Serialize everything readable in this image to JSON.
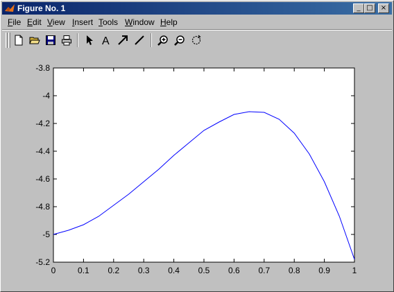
{
  "window": {
    "title": "Figure No. 1",
    "controls": {
      "minimize": "_",
      "maximize": "□",
      "close": "×"
    }
  },
  "menu": {
    "items": [
      {
        "label": "File",
        "u": "F",
        "rest": "ile"
      },
      {
        "label": "Edit",
        "u": "E",
        "rest": "dit"
      },
      {
        "label": "View",
        "u": "V",
        "rest": "iew"
      },
      {
        "label": "Insert",
        "u": "I",
        "rest": "nsert"
      },
      {
        "label": "Tools",
        "u": "T",
        "rest": "ools"
      },
      {
        "label": "Window",
        "u": "W",
        "rest": "indow"
      },
      {
        "label": "Help",
        "u": "H",
        "rest": "elp"
      }
    ]
  },
  "toolbar": {
    "icons": [
      "new-file-icon",
      "open-folder-icon",
      "save-icon",
      "print-icon",
      "arrow-pointer-icon",
      "insert-text-icon",
      "insert-arrow-icon",
      "insert-line-icon",
      "zoom-in-icon",
      "zoom-out-icon",
      "rotate-3d-icon"
    ],
    "text_tool_glyph": "A"
  },
  "colors": {
    "line": "#0000ff",
    "plot_bg": "#ffffff",
    "figure_bg": "#c0c0c0",
    "title_start": "#0a246a",
    "title_end": "#3a6ea5"
  },
  "chart_data": {
    "type": "line",
    "title": "",
    "xlabel": "",
    "ylabel": "",
    "xlim": [
      0,
      1
    ],
    "ylim": [
      -5.2,
      -3.8
    ],
    "grid": false,
    "xticks": [
      0,
      0.1,
      0.2,
      0.3,
      0.4,
      0.5,
      0.6,
      0.7,
      0.8,
      0.9,
      1
    ],
    "xtick_labels": [
      "0",
      "0.1",
      "0.2",
      "0.3",
      "0.4",
      "0.5",
      "0.6",
      "0.7",
      "0.8",
      "0.9",
      "1"
    ],
    "yticks": [
      -3.8,
      -4,
      -4.2,
      -4.4,
      -4.6,
      -4.8,
      -5,
      -5.2
    ],
    "ytick_labels": [
      "-3.8",
      "-4",
      "-4.2",
      "-4.4",
      "-4.6",
      "-4.8",
      "-5",
      "-5.2"
    ],
    "series": [
      {
        "color": "#0000ff",
        "x": [
          0,
          0.05,
          0.1,
          0.15,
          0.2,
          0.25,
          0.3,
          0.35,
          0.4,
          0.45,
          0.5,
          0.55,
          0.6,
          0.65,
          0.7,
          0.75,
          0.8,
          0.85,
          0.9,
          0.95,
          1
        ],
        "y": [
          -5.0,
          -4.97,
          -4.93,
          -4.87,
          -4.79,
          -4.71,
          -4.62,
          -4.53,
          -4.43,
          -4.34,
          -4.25,
          -4.19,
          -4.135,
          -4.115,
          -4.12,
          -4.17,
          -4.27,
          -4.42,
          -4.62,
          -4.87,
          -5.18
        ]
      }
    ]
  }
}
